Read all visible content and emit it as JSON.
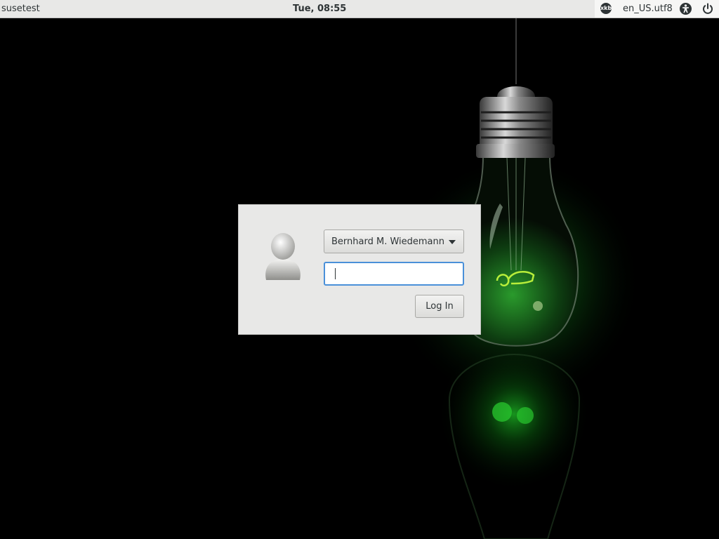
{
  "top_panel": {
    "hostname": "susetest",
    "clock": "Tue, 08:55",
    "keyboard_indicator": "xkb",
    "locale": "en_US.utf8",
    "accessibility_icon": "accessibility-icon",
    "power_icon": "power-icon",
    "background": "#e8e8e7"
  },
  "login": {
    "selected_user": "Bernhard M. Wiedemann",
    "password_value": "",
    "login_button_label": "Log In",
    "focus_color": "#4a90d9"
  },
  "wallpaper": {
    "icon": "lightbulb-geeko-wallpaper",
    "accent_color": "#2fd23f"
  }
}
